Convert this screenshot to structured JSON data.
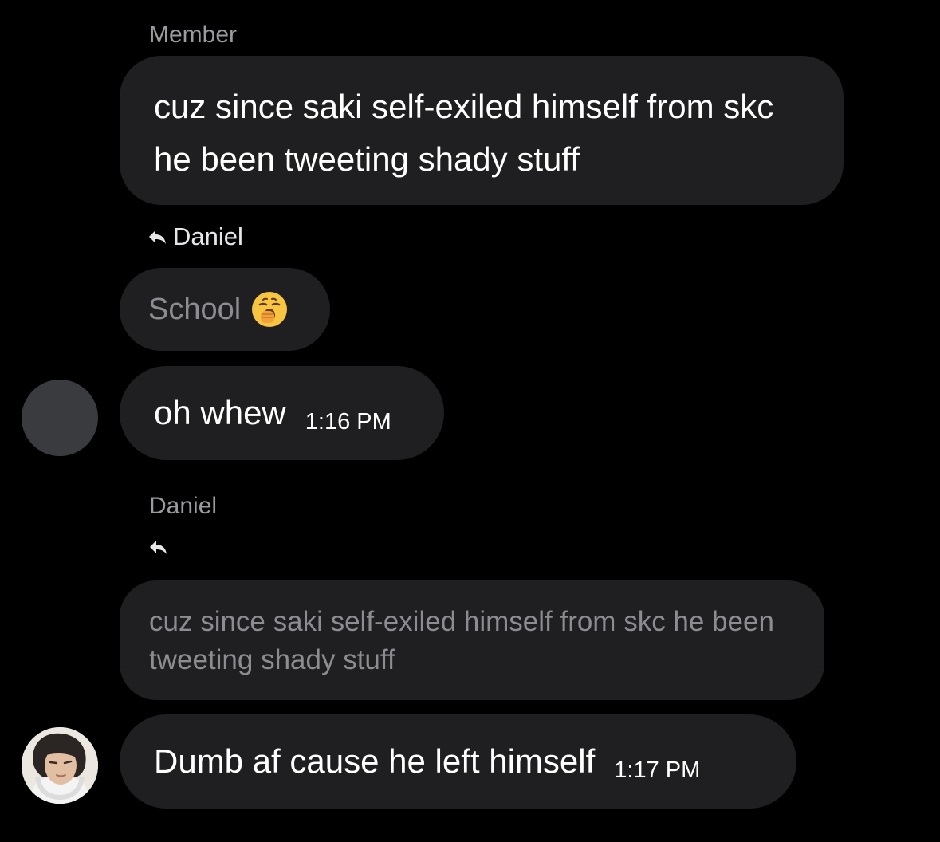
{
  "messages": {
    "first": {
      "sender": "Member",
      "text": "cuz since saki self-exiled himself from skc he been tweeting shady stuff"
    },
    "second": {
      "reply_to": "Daniel",
      "quoted_text": "School",
      "quoted_emoji": "yawning-face",
      "text": "oh whew",
      "time": "1:16 PM"
    },
    "third": {
      "sender": "Daniel",
      "quoted_text": "cuz since saki self-exiled himself from skc he been tweeting shady stuff",
      "text": "Dumb af cause he left himself",
      "time": "1:17 PM"
    }
  },
  "icons": {
    "reply": "reply-arrow-icon",
    "avatar_placeholder": "avatar-placeholder",
    "avatar_photo": "avatar-photo"
  },
  "colors": {
    "background": "#000000",
    "bubble": "#1f1f21",
    "muted_text": "#8c8c91",
    "name_text": "#9a9a9f",
    "placeholder_avatar": "#3a3b3f"
  }
}
